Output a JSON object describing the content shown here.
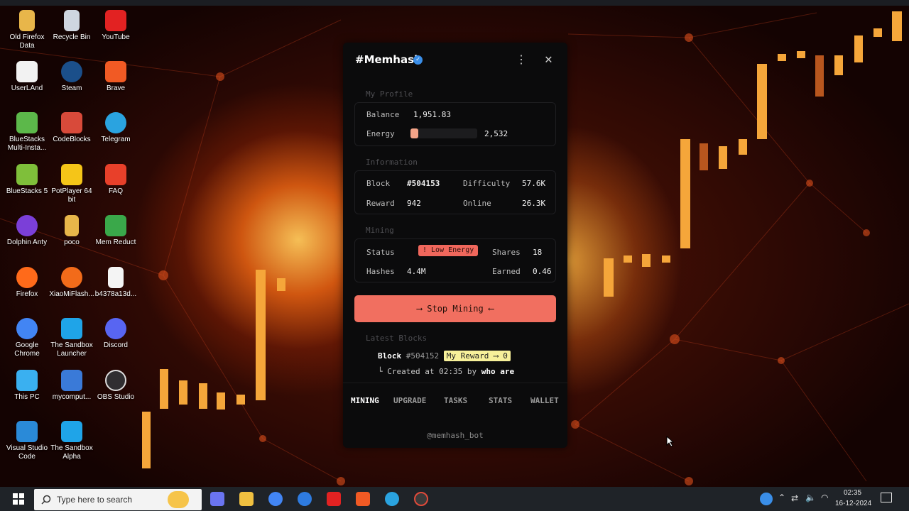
{
  "desktop_icons": [
    {
      "label": "Old Firefox Data",
      "color": "#e8b64a"
    },
    {
      "label": "Recycle Bin",
      "color": "#cfd6e0"
    },
    {
      "label": "YouTube",
      "color": "#e22222"
    },
    {
      "label": "UserLAnd",
      "color": "#f2f2f2"
    },
    {
      "label": "Steam",
      "color": "#1b4f8a"
    },
    {
      "label": "Brave",
      "color": "#f15a24"
    },
    {
      "label": "BlueStacks Multi-Insta...",
      "color": "#5cb84a"
    },
    {
      "label": "CodeBlocks",
      "color": "#d84a3a"
    },
    {
      "label": "Telegram",
      "color": "#2aa3e0"
    },
    {
      "label": "BlueStacks 5",
      "color": "#7fbf3a"
    },
    {
      "label": "PotPlayer 64 bit",
      "color": "#f5c518"
    },
    {
      "label": "FAQ",
      "color": "#e8402a"
    },
    {
      "label": "Dolphin Anty",
      "color": "#7b3fd8"
    },
    {
      "label": "poco",
      "color": "#e8b64a"
    },
    {
      "label": "Mem Reduct",
      "color": "#3aa84a"
    },
    {
      "label": "Firefox",
      "color": "#ff6a1a"
    },
    {
      "label": "XiaoMiFlash...",
      "color": "#f26b1a"
    },
    {
      "label": "b4378a13d...",
      "color": "#f4f4f4"
    },
    {
      "label": "Google Chrome",
      "color": "#4285f4"
    },
    {
      "label": "The Sandbox Launcher",
      "color": "#1fa4e8"
    },
    {
      "label": "Discord",
      "color": "#5865f2"
    },
    {
      "label": "This PC",
      "color": "#3ab0f0"
    },
    {
      "label": "mycomput...",
      "color": "#3a7ad8"
    },
    {
      "label": "OBS Studio",
      "color": "#302e31"
    },
    {
      "label": "Visual Studio Code",
      "color": "#2a8ad8"
    },
    {
      "label": "The Sandbox Alpha",
      "color": "#1fa4e8"
    }
  ],
  "memhash": {
    "title": "#Memhash",
    "profile_header": "My Profile",
    "balance_label": "Balance",
    "balance_value": "1,951.83",
    "energy_label": "Energy",
    "energy_value": "2,532",
    "energy_level_percent": 12,
    "info_header": "Information",
    "block_label": "Block",
    "block_value": "#504153",
    "difficulty_label": "Difficulty",
    "difficulty_value": "57.6K",
    "reward_label": "Reward",
    "reward_value": "942",
    "online_label": "Online",
    "online_value": "26.3K",
    "mining_header": "Mining",
    "status_label": "Status",
    "status_value": "! Low Energy",
    "shares_label": "Shares",
    "shares_value": "18",
    "hashes_label": "Hashes",
    "hashes_value": "4.4M",
    "earned_label": "Earned",
    "earned_value": "0.46",
    "stop_button": "⟶ Stop Mining ⟵",
    "latest_header": "Latest Blocks",
    "latest_block_word": "Block",
    "latest_block_id": "#504152",
    "latest_reward": "My Reward ⟶ 0",
    "latest_created": "└ Created at 02:35 by",
    "latest_by": "who are",
    "nav": [
      "MINING",
      "UPGRADE",
      "TASKS",
      "STATS",
      "WALLET"
    ],
    "footer": "@memhash_bot",
    "accent_color": "#f16f60"
  },
  "taskbar": {
    "search_placeholder": "Type here to search",
    "time": "02:35",
    "date": "16-12-2024"
  }
}
